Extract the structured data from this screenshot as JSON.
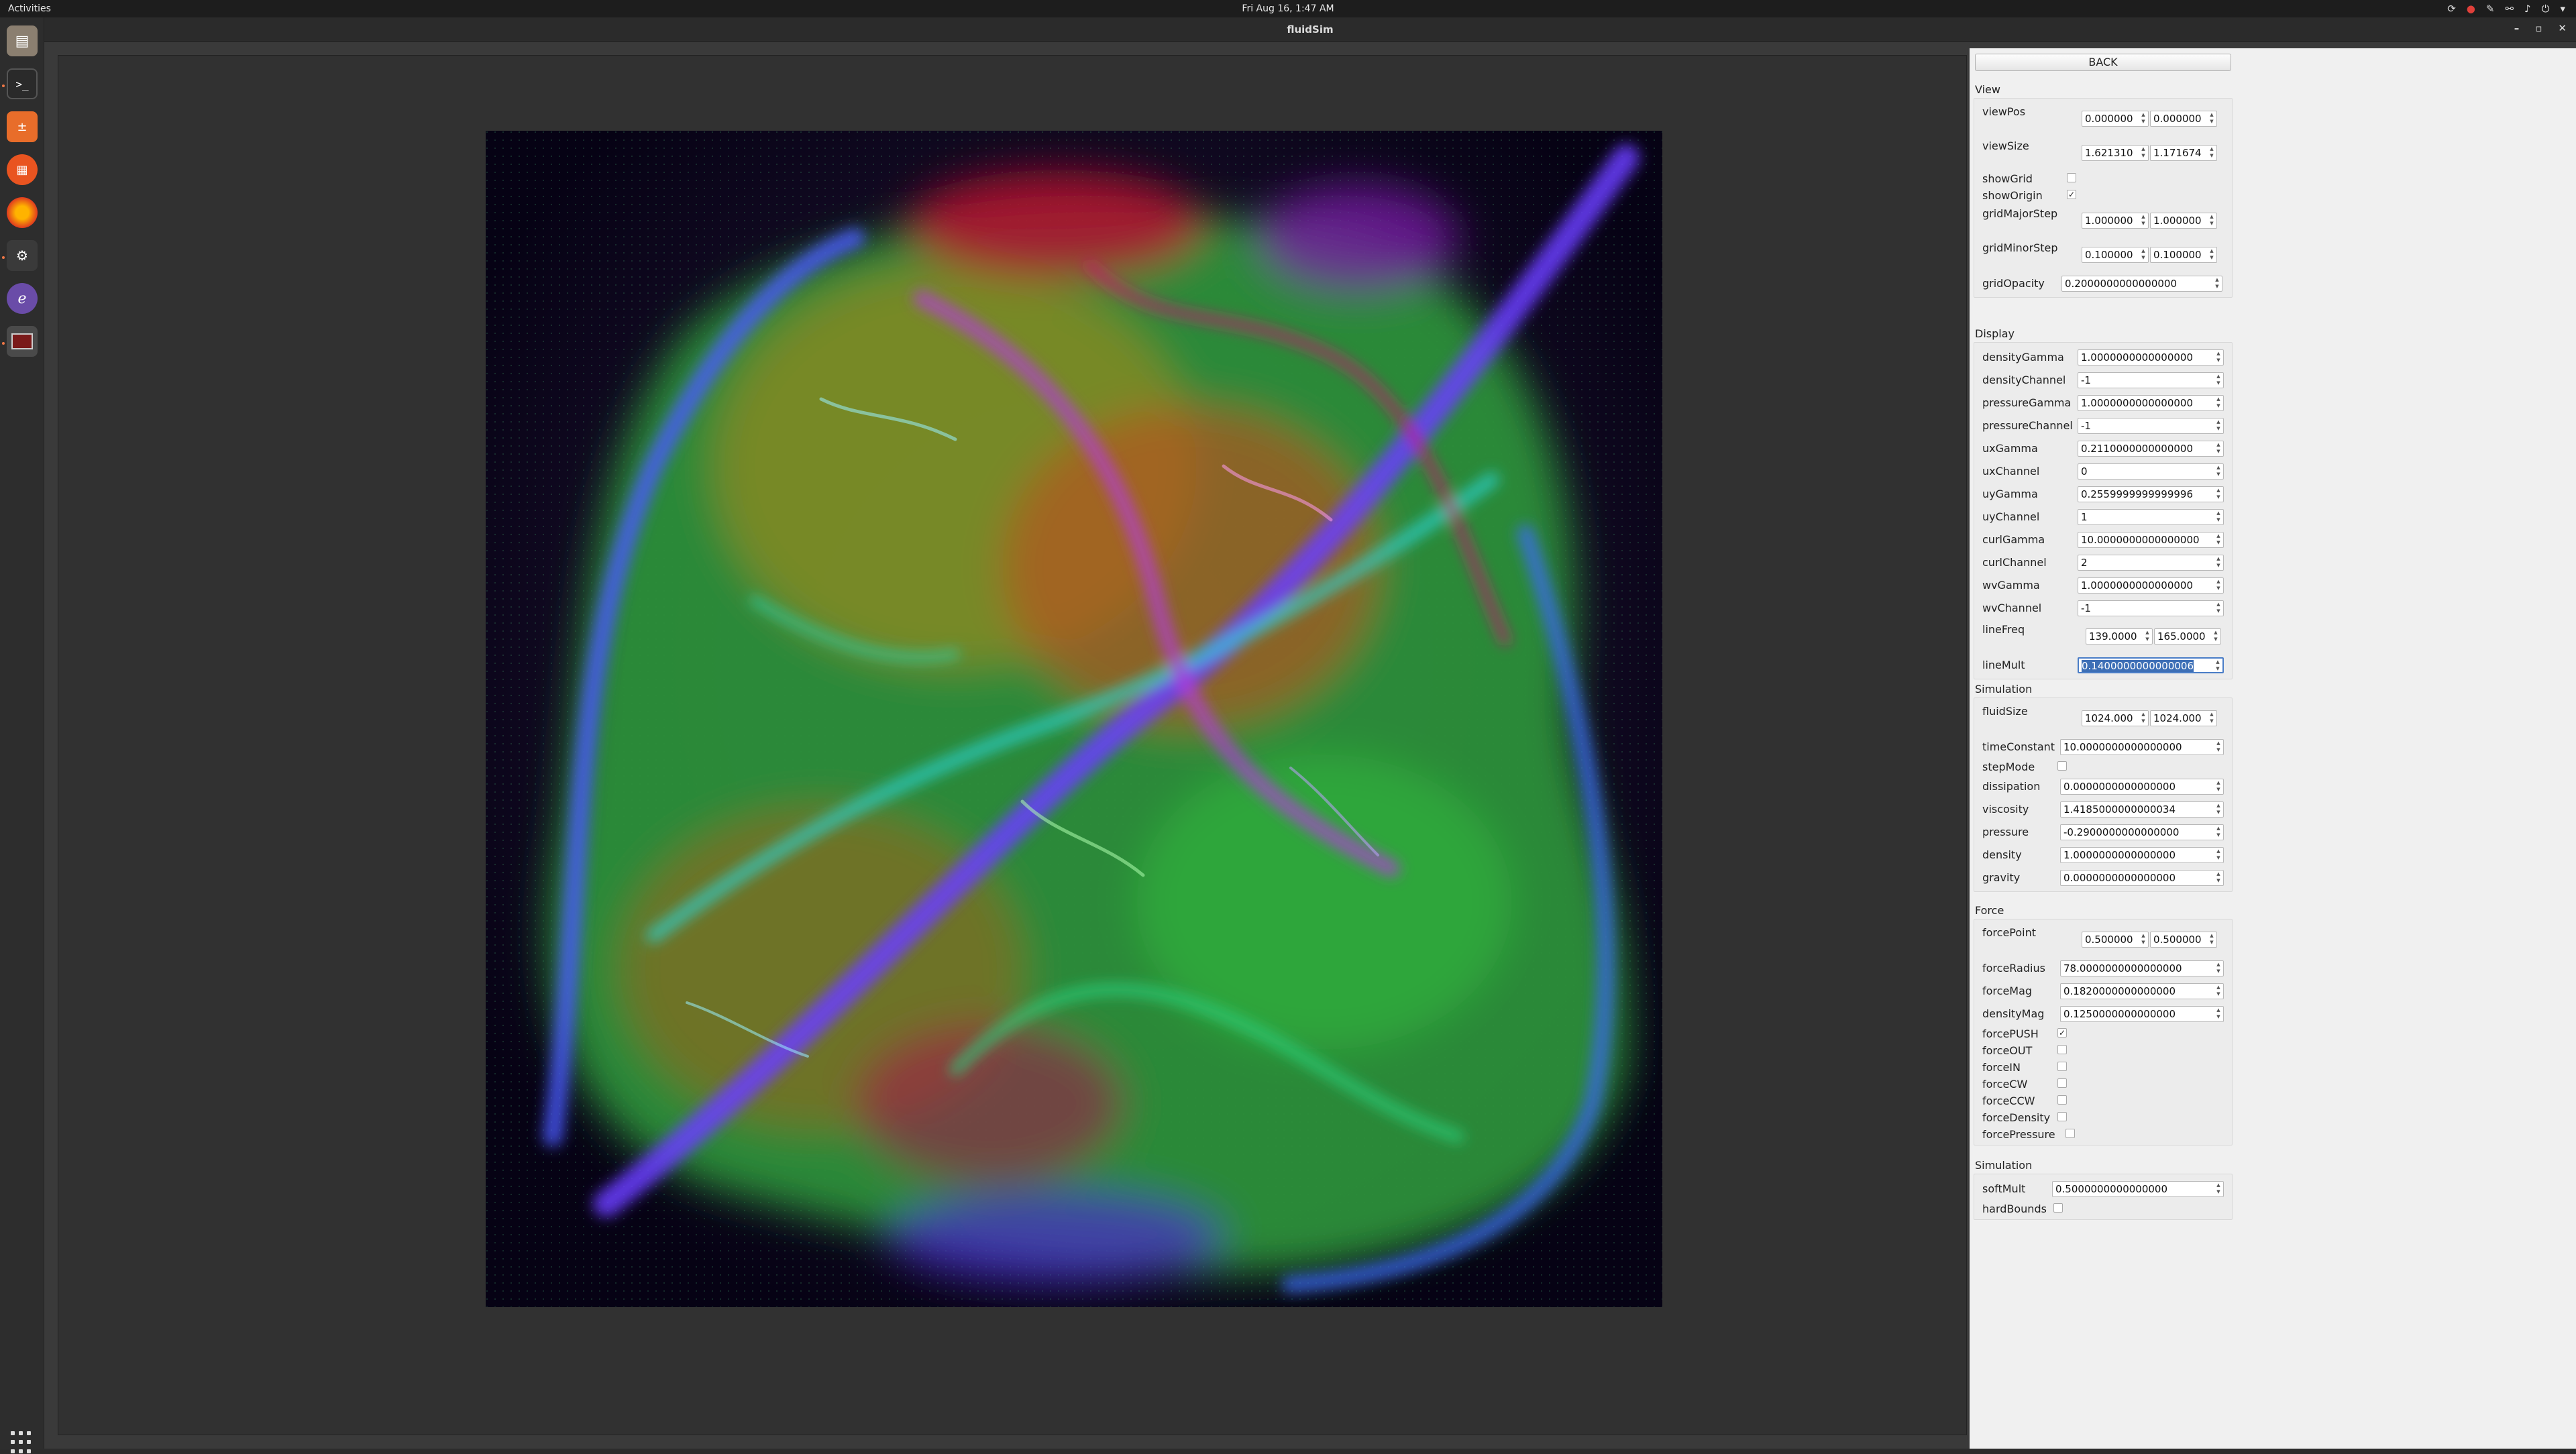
{
  "topbar": {
    "activities": "Activities",
    "clock": "Fri Aug 16,  1:47 AM"
  },
  "dock": {
    "items": [
      "files",
      "terminal",
      "calculator",
      "ubuntu-software",
      "firefox",
      "system-monitor",
      "emacs",
      "fluidsim"
    ]
  },
  "window": {
    "title": "fluidSim"
  },
  "panel": {
    "back_label": "BACK",
    "view": {
      "title": "View",
      "viewPos": {
        "label": "viewPos",
        "x": "0.000000",
        "y": "0.000000"
      },
      "viewSize": {
        "label": "viewSize",
        "x": "1.621310",
        "y": "1.171674"
      },
      "showGrid": {
        "label": "showGrid",
        "checked": false
      },
      "showOrigin": {
        "label": "showOrigin",
        "checked": true
      },
      "gridMajorStep": {
        "label": "gridMajorStep",
        "x": "1.000000",
        "y": "1.000000"
      },
      "gridMinorStep": {
        "label": "gridMinorStep",
        "x": "0.100000",
        "y": "0.100000"
      },
      "gridOpacity": {
        "label": "gridOpacity",
        "value": "0.2000000000000000"
      }
    },
    "display": {
      "title": "Display",
      "densityGamma": {
        "label": "densityGamma",
        "value": "1.0000000000000000"
      },
      "densityChannel": {
        "label": "densityChannel",
        "value": "-1"
      },
      "pressureGamma": {
        "label": "pressureGamma",
        "value": "1.0000000000000000"
      },
      "pressureChannel": {
        "label": "pressureChannel",
        "value": "-1"
      },
      "uxGamma": {
        "label": "uxGamma",
        "value": "0.2110000000000000"
      },
      "uxChannel": {
        "label": "uxChannel",
        "value": "0"
      },
      "uyGamma": {
        "label": "uyGamma",
        "value": "0.2559999999999996"
      },
      "uyChannel": {
        "label": "uyChannel",
        "value": "1"
      },
      "curlGamma": {
        "label": "curlGamma",
        "value": "10.0000000000000000"
      },
      "curlChannel": {
        "label": "curlChannel",
        "value": "2"
      },
      "wvGamma": {
        "label": "wvGamma",
        "value": "1.0000000000000000"
      },
      "wvChannel": {
        "label": "wvChannel",
        "value": "-1"
      },
      "lineFreq": {
        "label": "lineFreq",
        "x": "139.0000",
        "y": "165.0000"
      },
      "lineMult": {
        "label": "lineMult",
        "value": "0.1400000000000006"
      }
    },
    "simulation": {
      "title": "Simulation",
      "fluidSize": {
        "label": "fluidSize",
        "x": "1024.000",
        "y": "1024.000"
      },
      "timeConstant": {
        "label": "timeConstant",
        "value": "10.0000000000000000"
      },
      "stepMode": {
        "label": "stepMode",
        "checked": false
      },
      "dissipation": {
        "label": "dissipation",
        "value": "0.0000000000000000"
      },
      "viscosity": {
        "label": "viscosity",
        "value": "1.4185000000000034"
      },
      "pressure": {
        "label": "pressure",
        "value": "-0.2900000000000000"
      },
      "density": {
        "label": "density",
        "value": "1.0000000000000000"
      },
      "gravity": {
        "label": "gravity",
        "value": "0.0000000000000000"
      }
    },
    "force": {
      "title": "Force",
      "forcePoint": {
        "label": "forcePoint",
        "x": "0.500000",
        "y": "0.500000"
      },
      "forceRadius": {
        "label": "forceRadius",
        "value": "78.0000000000000000"
      },
      "forceMag": {
        "label": "forceMag",
        "value": "0.1820000000000000"
      },
      "densityMag": {
        "label": "densityMag",
        "value": "0.1250000000000000"
      },
      "forcePUSH": {
        "label": "forcePUSH",
        "checked": true
      },
      "forceOUT": {
        "label": "forceOUT",
        "checked": false
      },
      "forceIN": {
        "label": "forceIN",
        "checked": false
      },
      "forceCW": {
        "label": "forceCW",
        "checked": false
      },
      "forceCCW": {
        "label": "forceCCW",
        "checked": false
      },
      "forceDensity": {
        "label": "forceDensity",
        "checked": false
      },
      "forcePressure": {
        "label": "forcePressure",
        "checked": false
      }
    },
    "simulation2": {
      "title": "Simulation",
      "softMult": {
        "label": "softMult",
        "value": "0.5000000000000000"
      },
      "hardBounds": {
        "label": "hardBounds",
        "checked": false
      }
    }
  }
}
